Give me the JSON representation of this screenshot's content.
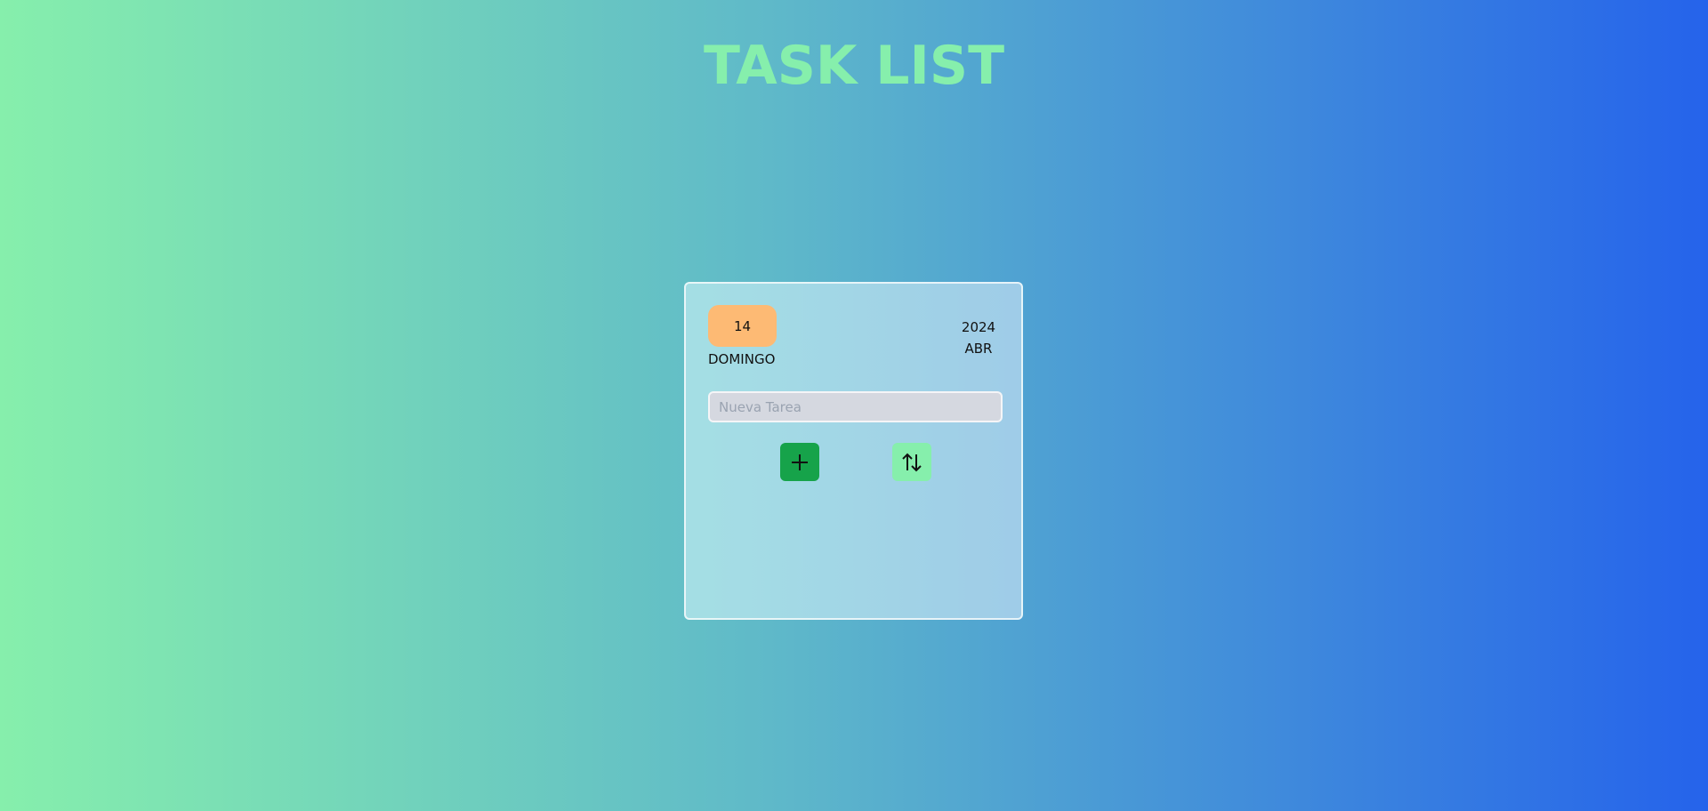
{
  "header": {
    "title": "TASK LIST"
  },
  "date": {
    "day": "14",
    "weekday": "DOMINGO",
    "year": "2024",
    "month": "ABR"
  },
  "task_input": {
    "value": "",
    "placeholder": "Nueva Tarea"
  },
  "buttons": {
    "add_icon": "plus-icon",
    "sort_icon": "sort-arrows-icon"
  },
  "colors": {
    "title": "#86efac",
    "day_badge": "#fdba74",
    "add_button": "#16a34a",
    "sort_button": "#86efac",
    "gradient_start": "#86efac",
    "gradient_end": "#2563eb"
  },
  "tasks": []
}
